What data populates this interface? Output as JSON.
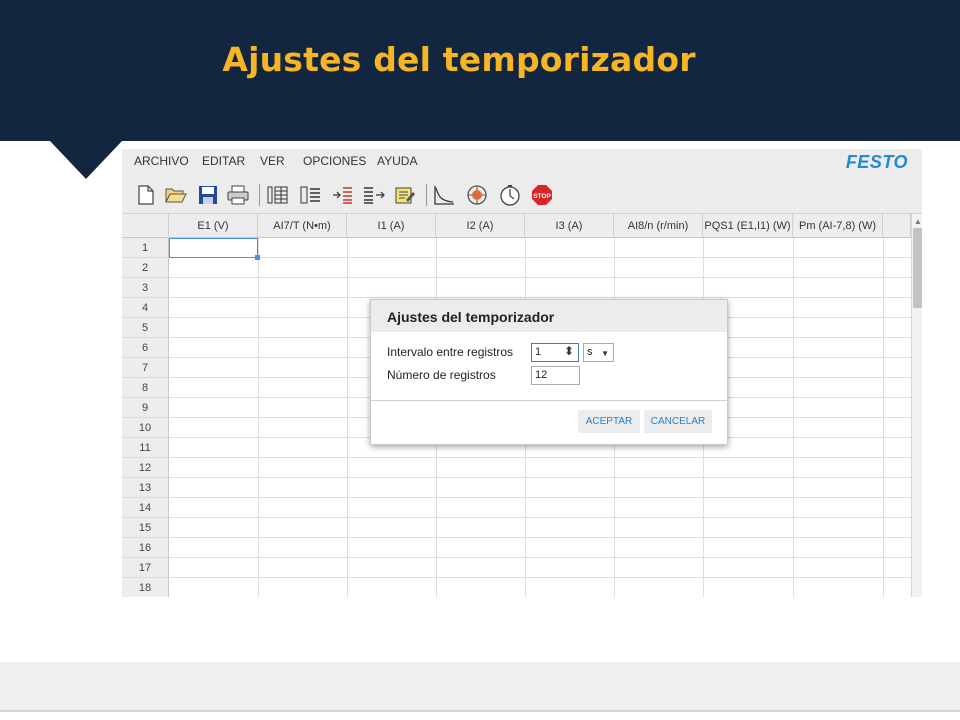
{
  "slide": {
    "title": "Ajustes del temporizador"
  },
  "app": {
    "logo": "FESTO",
    "menu": [
      "ARCHIVO",
      "EDITAR",
      "VER",
      "OPCIONES",
      "AYUDA"
    ],
    "toolbar_icons": [
      "new-file-icon",
      "open-folder-icon",
      "save-icon",
      "print-icon",
      "columns-icon",
      "list-icon",
      "import-icon",
      "export-icon",
      "edit-icon",
      "chart-icon",
      "measure-icon",
      "timer-icon",
      "stop-icon"
    ],
    "stop_label": "STOP",
    "columns": [
      "E1 (V)",
      "AI7/T (N•m)",
      "I1 (A)",
      "I2 (A)",
      "I3 (A)",
      "AI8/n (r/min)",
      "PQS1 (E1,I1) (W)",
      "Pm (AI-7,8) (W)"
    ],
    "rows": [
      "1",
      "2",
      "3",
      "4",
      "5",
      "6",
      "7",
      "8",
      "9",
      "10",
      "11",
      "12",
      "13",
      "14",
      "15",
      "16",
      "17",
      "18"
    ]
  },
  "dialog": {
    "title": "Ajustes del temporizador",
    "interval_label": "Intervalo entre registros",
    "interval_value": "1",
    "unit_value": "s",
    "count_label": "Número de registros",
    "count_value": "12",
    "accept_label": "ACEPTAR",
    "cancel_label": "CANCELAR"
  },
  "colors": {
    "banner": "#12263f",
    "title": "#f7b525",
    "accent": "#1f8bd0"
  }
}
